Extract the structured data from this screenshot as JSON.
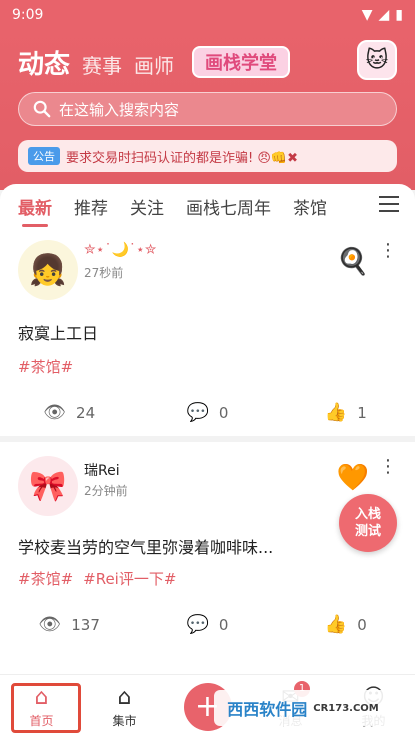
{
  "status_bar": {
    "time": "9:09"
  },
  "header": {
    "tabs": [
      "动态",
      "赛事",
      "画师"
    ],
    "badge": "画栈学堂",
    "search_placeholder": "在这输入搜索内容",
    "notice_tag": "公告",
    "notice_text": "要求交易时扫码认证的都是诈骗! 😠👊✖"
  },
  "categories": [
    "最新",
    "推荐",
    "关注",
    "画栈七周年",
    "茶馆"
  ],
  "posts": [
    {
      "name": "✮⋆˙🌙˙⋆✮",
      "time": "27秒前",
      "text": "寂寞上工日",
      "tags": [
        "#茶馆#"
      ],
      "views": "24",
      "comments": "0",
      "likes": "1"
    },
    {
      "name": "瑞Rei",
      "time": "2分钟前",
      "text": "学校麦当劳的空气里弥漫着咖啡味...",
      "tags": [
        "#茶馆#",
        "#Rei评一下#"
      ],
      "views": "137",
      "comments": "0",
      "likes": "0"
    }
  ],
  "fab": {
    "line1": "入栈",
    "line2": "测试"
  },
  "bottom_nav": [
    {
      "label": "首页",
      "icon": "home-icon"
    },
    {
      "label": "集市",
      "icon": "shop-icon"
    },
    {
      "label": "",
      "icon": "add-icon"
    },
    {
      "label": "消息",
      "icon": "message-icon",
      "badge": "1"
    },
    {
      "label": "我的",
      "icon": "profile-icon"
    }
  ],
  "watermark": {
    "brand": "西西软件园",
    "site": "CR173.COM"
  }
}
